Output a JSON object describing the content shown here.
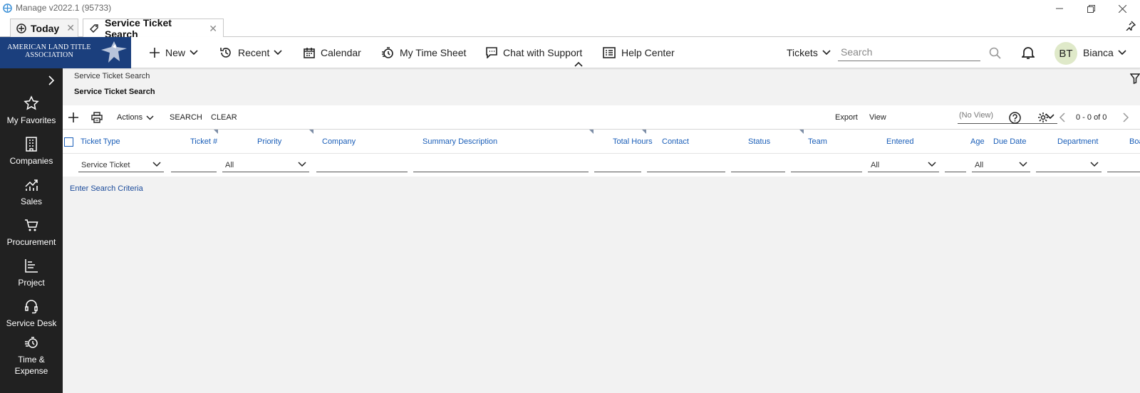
{
  "window": {
    "title": "Manage v2022.1 (95733)"
  },
  "tabs": [
    {
      "label": "Today"
    },
    {
      "label": "Service Ticket Search"
    }
  ],
  "logo": {
    "text": "AMERICAN LAND TITLE ASSOCIATION"
  },
  "nav": {
    "new": "New",
    "recent": "Recent",
    "calendar": "Calendar",
    "timesheet": "My Time Sheet",
    "chat": "Chat with Support",
    "help": "Help Center",
    "search_scope": "Tickets",
    "search_placeholder": "Search",
    "user_initials": "BT",
    "user_name": "Bianca"
  },
  "sidebar": {
    "items": [
      {
        "label": "My Favorites",
        "icon": "star-icon"
      },
      {
        "label": "Companies",
        "icon": "building-icon"
      },
      {
        "label": "Sales",
        "icon": "chart-icon"
      },
      {
        "label": "Procurement",
        "icon": "cart-icon"
      },
      {
        "label": "Project",
        "icon": "project-icon"
      },
      {
        "label": "Service Desk",
        "icon": "headset-icon"
      },
      {
        "label": "Time & Expense",
        "icon": "clock-icon"
      }
    ]
  },
  "page": {
    "breadcrumb": "Service Ticket Search",
    "title": "Service Ticket Search"
  },
  "toolbar": {
    "actions": "Actions",
    "search": "SEARCH",
    "clear": "CLEAR",
    "export": "Export",
    "view": "View",
    "view_value": "(No View)",
    "pagination": "0 - 0 of 0"
  },
  "columns": [
    "Ticket Type",
    "Ticket #",
    "Priority",
    "Company",
    "Summary Description",
    "Total Hours",
    "Contact",
    "Status",
    "Team",
    "Entered",
    "Age",
    "Due Date",
    "Department",
    "Boa"
  ],
  "filters": {
    "ticket_type": "Service Ticket",
    "priority": "All",
    "entered": "All",
    "due_date": "All"
  },
  "hint": "Enter Search Criteria",
  "colors": {
    "brand": "#1b3f7d",
    "sidebar": "#212121",
    "link": "#1a5eb8"
  }
}
